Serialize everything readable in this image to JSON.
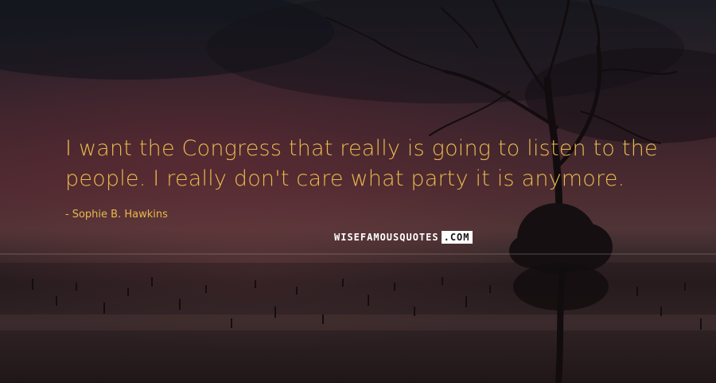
{
  "quote": {
    "line1": "I want the Congress that really is going to listen to the",
    "line2": "people. I really don't care what party it is anymore."
  },
  "author": {
    "dash": "-",
    "name": "Sophie B. Hawkins"
  },
  "watermark": {
    "main": "WISEFAMOUSQUOTES",
    "tld": ".COM"
  },
  "colors": {
    "quote_text": "#e9b94d",
    "watermark_text": "#ffffff"
  }
}
